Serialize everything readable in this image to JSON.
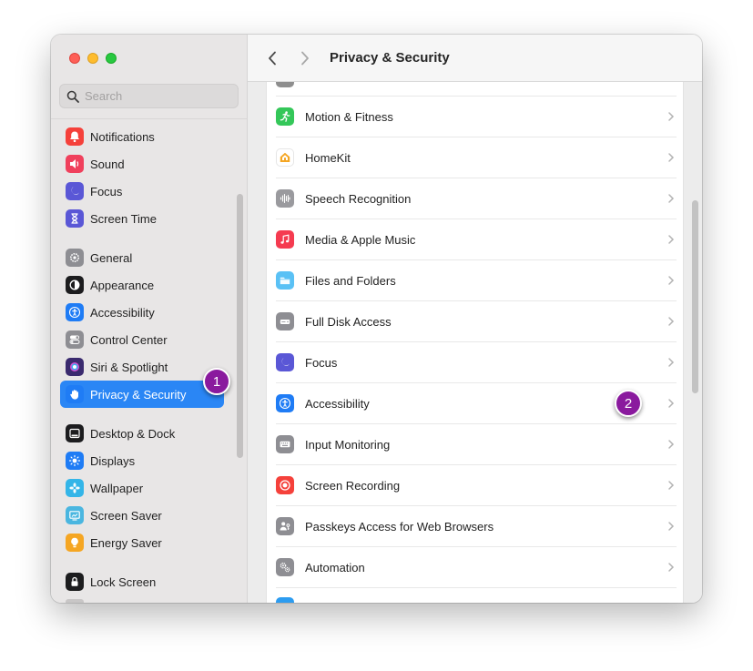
{
  "window": {
    "title": "Privacy & Security"
  },
  "search": {
    "placeholder": "Search"
  },
  "sidebar": {
    "items": [
      {
        "label": "Notifications",
        "icon": "bell-icon",
        "color": "#f5413b"
      },
      {
        "label": "Sound",
        "icon": "speaker-icon",
        "color": "#f0405c"
      },
      {
        "label": "Focus",
        "icon": "moon-icon",
        "color": "#5a57d6"
      },
      {
        "label": "Screen Time",
        "icon": "hourglass-icon",
        "color": "#5a57d6"
      },
      {
        "label": "General",
        "icon": "gear-icon",
        "color": "#8e8e93"
      },
      {
        "label": "Appearance",
        "icon": "appearance-icon",
        "color": "#1c1c1e"
      },
      {
        "label": "Accessibility",
        "icon": "accessibility-icon",
        "color": "#1f7cf5"
      },
      {
        "label": "Control Center",
        "icon": "toggles-icon",
        "color": "#8e8e93"
      },
      {
        "label": "Siri & Spotlight",
        "icon": "siri-icon",
        "color": "#3a2a6e"
      },
      {
        "label": "Privacy & Security",
        "icon": "hand-icon",
        "color": "#1f7cf5",
        "selected": true
      },
      {
        "label": "Desktop & Dock",
        "icon": "dock-icon",
        "color": "#1c1c1e"
      },
      {
        "label": "Displays",
        "icon": "sun-icon",
        "color": "#1f7cf5"
      },
      {
        "label": "Wallpaper",
        "icon": "flower-icon",
        "color": "#33b5e8"
      },
      {
        "label": "Screen Saver",
        "icon": "screensaver-icon",
        "color": "#4ab6e0"
      },
      {
        "label": "Energy Saver",
        "icon": "bulb-icon",
        "color": "#f5a623"
      },
      {
        "label": "Lock Screen",
        "icon": "lock-icon",
        "color": "#1c1c1e"
      }
    ]
  },
  "content": {
    "rows": [
      {
        "label": "Motion & Fitness",
        "icon": "fitness-icon",
        "color": "#34c759"
      },
      {
        "label": "HomeKit",
        "icon": "home-icon",
        "color": "#ffffff"
      },
      {
        "label": "Speech Recognition",
        "icon": "waveform-icon",
        "color": "#9a9a9e"
      },
      {
        "label": "Media & Apple Music",
        "icon": "music-icon",
        "color": "#f53b50"
      },
      {
        "label": "Files and Folders",
        "icon": "folder-icon",
        "color": "#5ac1f5"
      },
      {
        "label": "Full Disk Access",
        "icon": "disk-icon",
        "color": "#8e8e93"
      },
      {
        "label": "Focus",
        "icon": "moon-icon",
        "color": "#5a57d6"
      },
      {
        "label": "Accessibility",
        "icon": "accessibility-icon",
        "color": "#1f7cf5"
      },
      {
        "label": "Input Monitoring",
        "icon": "keyboard-icon",
        "color": "#8e8e93"
      },
      {
        "label": "Screen Recording",
        "icon": "record-icon",
        "color": "#f5413b"
      },
      {
        "label": "Passkeys Access for Web Browsers",
        "icon": "passkey-icon",
        "color": "#8e8e93"
      },
      {
        "label": "Automation",
        "icon": "gears-icon",
        "color": "#8e8e93"
      }
    ]
  },
  "annotations": {
    "badge1": "1",
    "badge2": "2",
    "badge_color": "#8a1a9e"
  }
}
